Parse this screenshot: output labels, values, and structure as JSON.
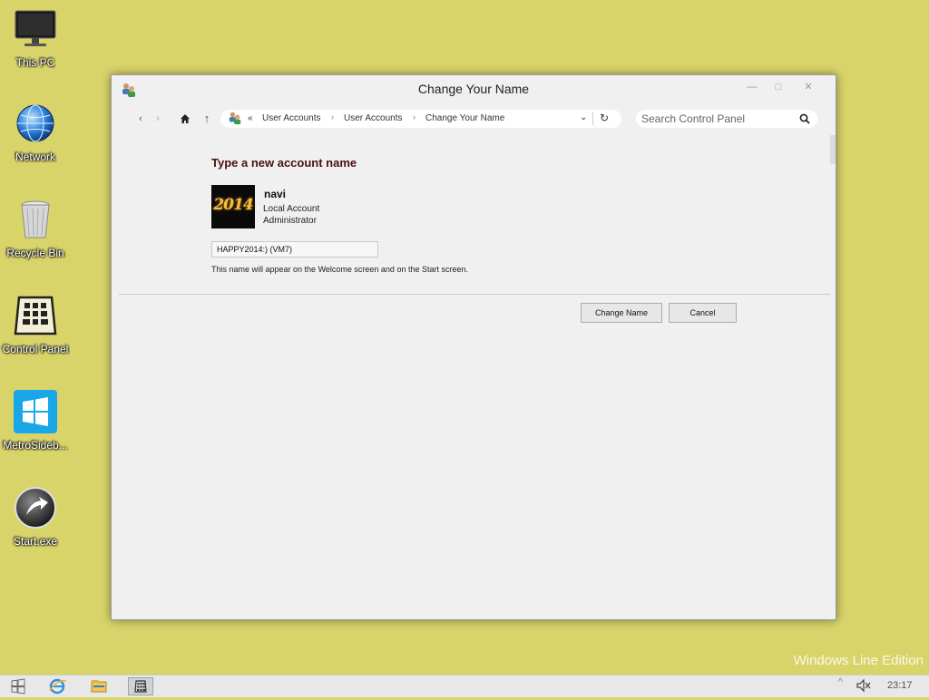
{
  "desktop": {
    "icons": [
      {
        "label": "This PC",
        "icon": "monitor-icon"
      },
      {
        "label": "Network",
        "icon": "network-globe-icon"
      },
      {
        "label": "Recycle Bin",
        "icon": "recycle-bin-icon"
      },
      {
        "label": "Control Panel",
        "icon": "control-panel-icon"
      },
      {
        "label": "MetroSideb...",
        "icon": "metro-sidebar-icon"
      },
      {
        "label": "Start.exe",
        "icon": "start-exe-icon"
      }
    ],
    "watermark": "Windows Line Edition",
    "background_color": "#d9d46a"
  },
  "window": {
    "title": "Change Your Name",
    "controls": {
      "minimize": "minimize-icon",
      "maximize": "maximize-icon",
      "close": "close-icon"
    },
    "nav": {
      "back": "back-icon",
      "forward": "forward-icon",
      "home": "home-icon",
      "up": "up-icon",
      "address_prefix": "«",
      "breadcrumbs": [
        "User Accounts",
        "User Accounts",
        "Change Your Name"
      ],
      "dropdown": "chevron-down-icon",
      "refresh": "refresh-icon",
      "search_placeholder": "Search Control Panel",
      "search_icon": "search-icon"
    },
    "content": {
      "heading": "Type a new account name",
      "avatar_text": "2014",
      "user_name": "navi",
      "account_type": "Local Account",
      "account_role": "Administrator",
      "name_value": "HAPPY2014:) (VM7)",
      "hint": "This name will appear on the Welcome screen and on the Start screen.",
      "change_button": "Change Name",
      "cancel_button": "Cancel"
    }
  },
  "taskbar": {
    "items": [
      "start-windows-icon",
      "internet-explorer-icon",
      "file-explorer-icon",
      "control-panel-icon"
    ],
    "tray_chevron": "^",
    "volume": "volume-muted-icon",
    "clock": "23:17"
  }
}
